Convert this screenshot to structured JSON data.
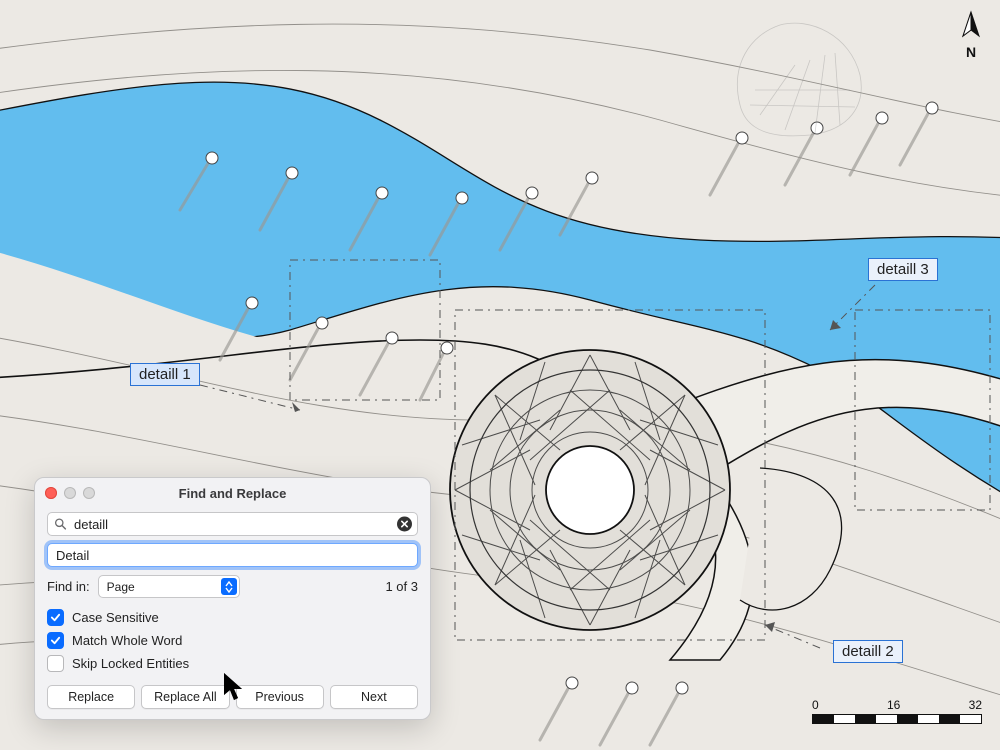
{
  "compass": {
    "direction_label": "N"
  },
  "scale": {
    "ticks": [
      "0",
      "16",
      "32"
    ]
  },
  "annotations": {
    "detail1": "detaill 1",
    "detail2": "detaill 2",
    "detail3": "detaill 3"
  },
  "dialog": {
    "title": "Find and Replace",
    "find_value": "detaill",
    "replace_value": "Detail",
    "find_in_label": "Find in:",
    "scope_value": "Page",
    "count_text": "1 of 3",
    "options": {
      "case_sensitive": {
        "label": "Case Sensitive",
        "checked": true
      },
      "match_whole_word": {
        "label": "Match Whole Word",
        "checked": true
      },
      "skip_locked": {
        "label": "Skip Locked Entities",
        "checked": false
      }
    },
    "buttons": {
      "replace": "Replace",
      "replace_all": "Replace All",
      "previous": "Previous",
      "next": "Next"
    }
  }
}
